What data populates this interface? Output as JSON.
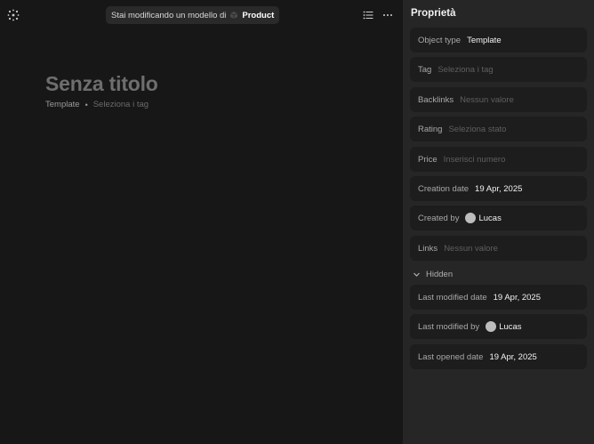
{
  "banner": {
    "text": "Stai modificando un modello di",
    "type_name": "Product"
  },
  "page": {
    "title": "Senza titolo",
    "type": "Template",
    "separator": "•",
    "tags_placeholder": "Seleziona i tag"
  },
  "panel": {
    "title": "Proprietà",
    "properties": [
      {
        "label": "Object type",
        "value": "Template",
        "empty": false
      },
      {
        "label": "Tag",
        "value": "Seleziona i tag",
        "empty": true
      },
      {
        "label": "Backlinks",
        "value": "Nessun valore",
        "empty": true
      },
      {
        "label": "Rating",
        "value": "Seleziona stato",
        "empty": true
      },
      {
        "label": "Price",
        "value": "Inserisci numero",
        "empty": true
      },
      {
        "label": "Creation date",
        "value": "19 Apr, 2025",
        "empty": false
      },
      {
        "label": "Created by",
        "value": "Lucas",
        "empty": false,
        "avatar": true
      },
      {
        "label": "Links",
        "value": "Nessun valore",
        "empty": true
      }
    ],
    "hidden_section": {
      "label": "Hidden",
      "expanded": true,
      "properties": [
        {
          "label": "Last modified date",
          "value": "19 Apr, 2025",
          "empty": false
        },
        {
          "label": "Last modified by",
          "value": "Lucas",
          "empty": false,
          "avatar": true
        },
        {
          "label": "Last opened date",
          "value": "19 Apr, 2025",
          "empty": false
        }
      ]
    }
  },
  "icons": {
    "graph": "graph-icon",
    "type": "product-type-icon",
    "toc": "table-of-contents-icon",
    "more": "more-icon",
    "chevron": "chevron-down-icon",
    "avatar": "user-avatar"
  },
  "colors": {
    "editor_bg": "#171717",
    "panel_bg": "#262626",
    "property_bg": "#1d1d1d",
    "title_placeholder": "#6e6e6e"
  }
}
